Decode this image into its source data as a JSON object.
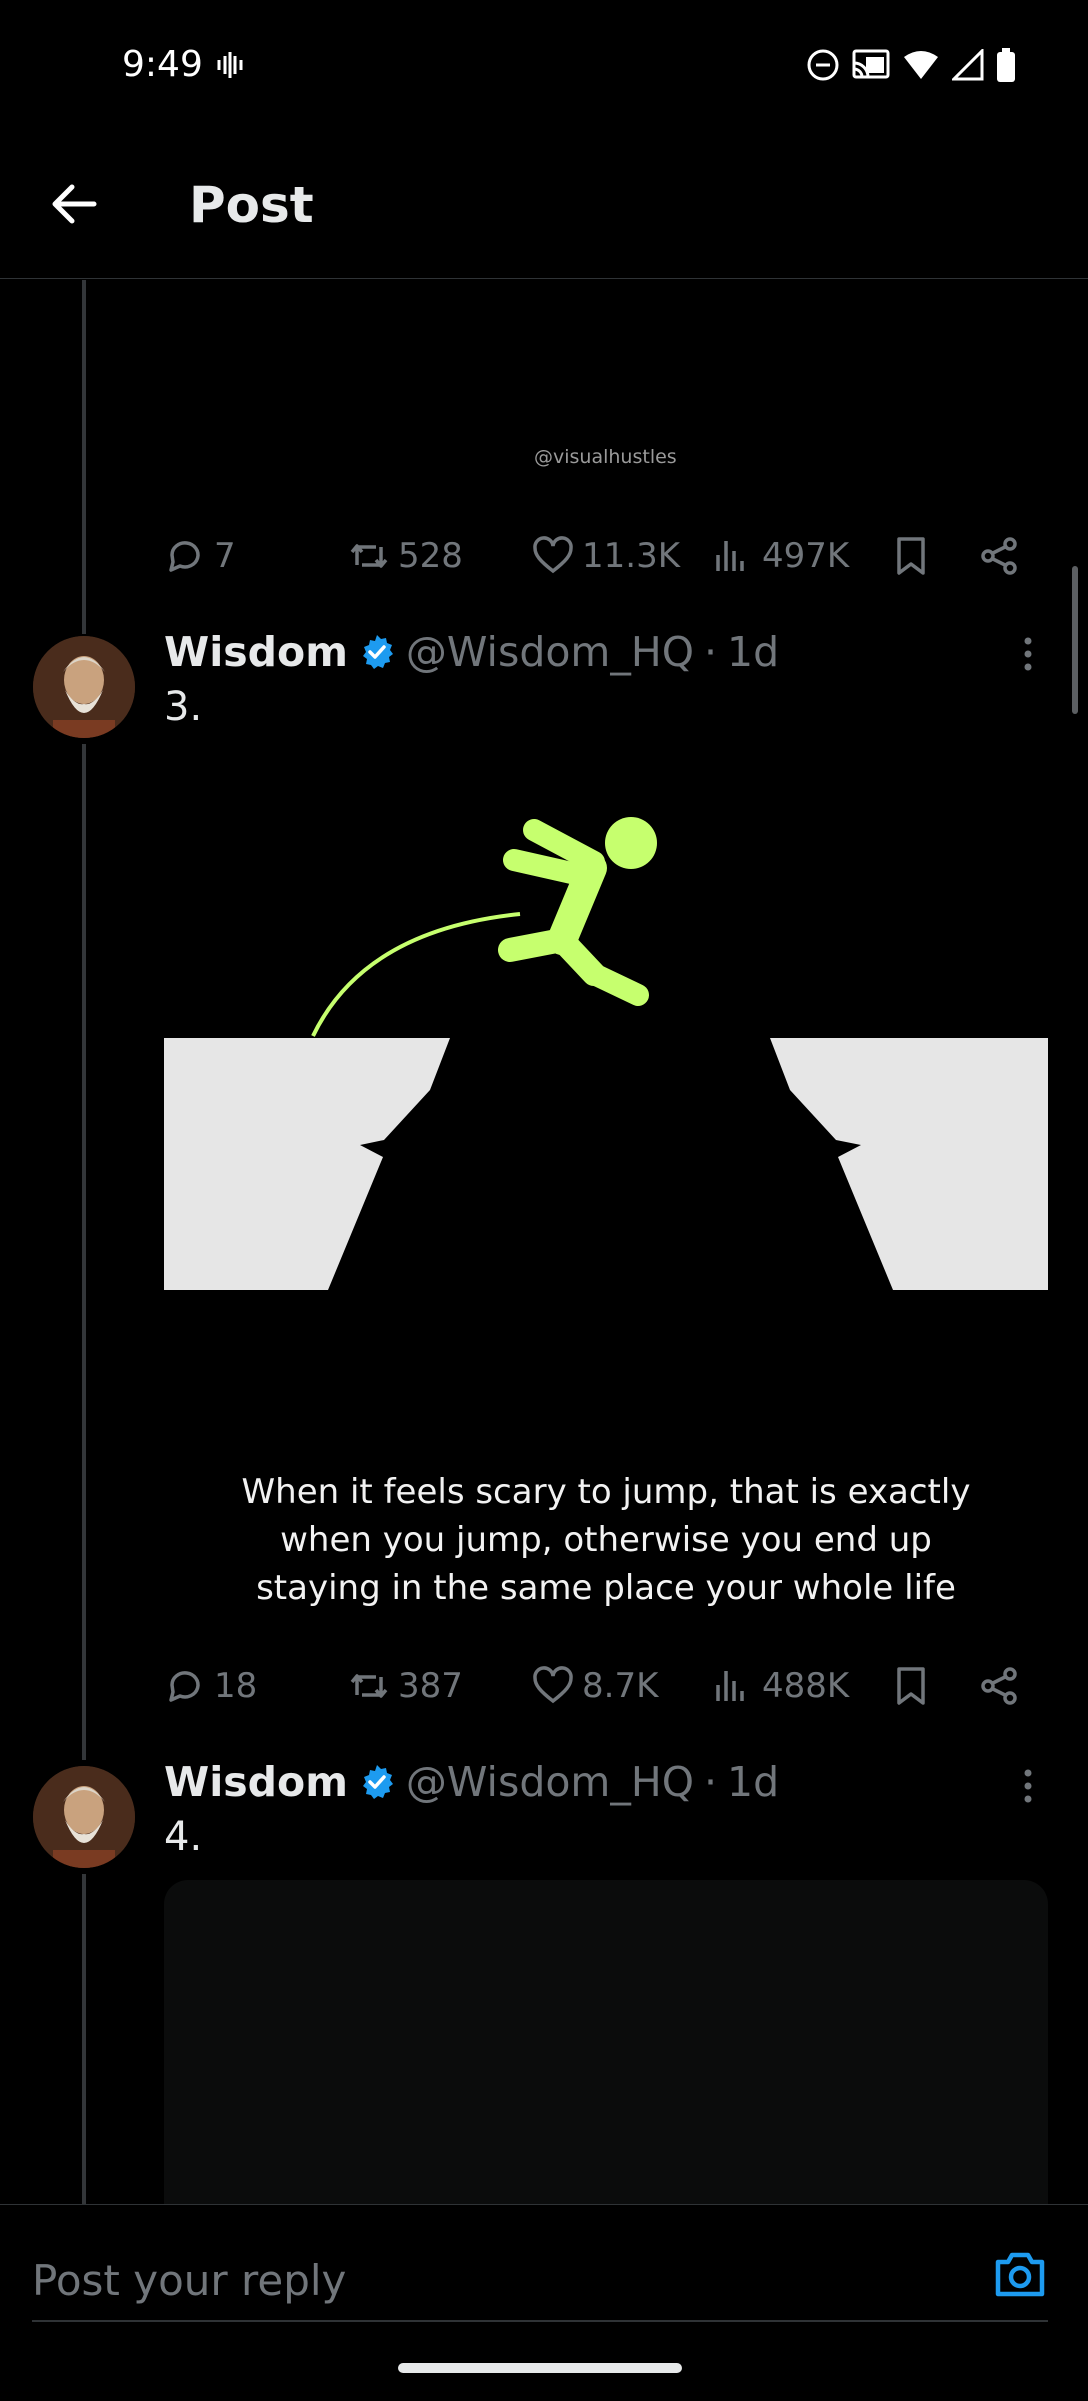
{
  "status_bar": {
    "time": "9:49"
  },
  "header": {
    "title": "Post"
  },
  "media_watermark": "@visualhustles",
  "tweets": [
    {
      "actions": {
        "replies": "7",
        "reposts": "528",
        "likes": "11.3K",
        "views": "497K"
      }
    },
    {
      "author": {
        "name": "Wisdom",
        "handle": "@Wisdom_HQ",
        "separator": "·",
        "time": "1d"
      },
      "text": "3.",
      "media_caption": [
        "When it feels scary to jump, that is exactly",
        "when you jump, otherwise you end up",
        "staying in the same place your whole life"
      ],
      "actions": {
        "replies": "18",
        "reposts": "387",
        "likes": "8.7K",
        "views": "488K"
      }
    },
    {
      "author": {
        "name": "Wisdom",
        "handle": "@Wisdom_HQ",
        "separator": "·",
        "time": "1d"
      },
      "text": "4."
    }
  ],
  "reply": {
    "placeholder": "Post your reply"
  },
  "colors": {
    "background": "#000000",
    "accent": "#1d9bf0",
    "muted": "#71767b",
    "figure": "#c6ff6e",
    "cliff": "#e6e6e6"
  }
}
